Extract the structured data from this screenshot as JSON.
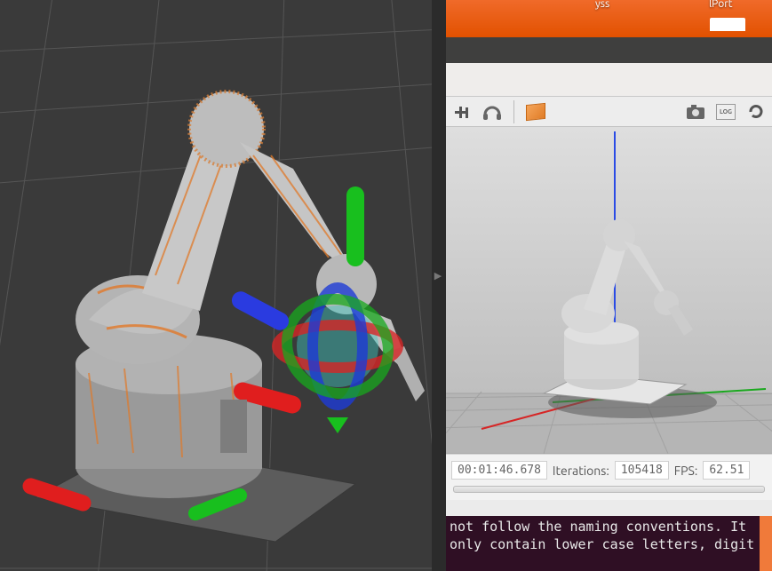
{
  "desktop": {
    "icon_labels": {
      "yss": "yss",
      "lport": "lPort"
    }
  },
  "gazebo": {
    "toolbar": {
      "insert_tool": "insert-tool",
      "headphones": "audio-tool",
      "box_tool": "box-primitive",
      "camera": "screenshot",
      "log": "LOG",
      "refresh": "refresh"
    },
    "status": {
      "time": "00:01:46.678",
      "iter_label": "Iterations:",
      "iterations": "105418",
      "fps_label": "FPS:",
      "fps": "62.51"
    },
    "model_name": "robot-arm"
  },
  "rviz": {
    "model_name": "robot-arm",
    "gizmo": {
      "x": "x-axis",
      "y": "y-axis",
      "z": "z-axis"
    }
  },
  "terminal": {
    "line1": "not follow the naming conventions. It",
    "line2": "only contain lower case letters, digit"
  }
}
